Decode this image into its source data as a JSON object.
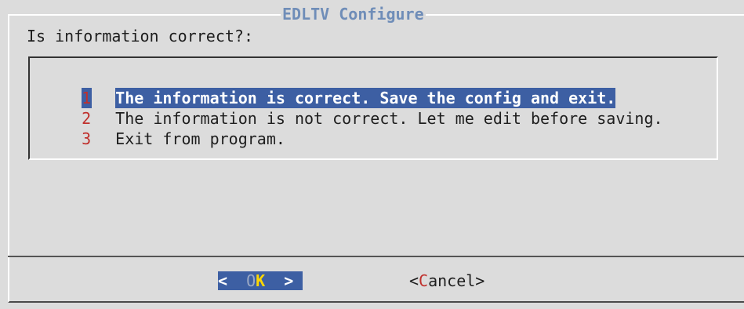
{
  "dialog": {
    "title": "EDLTV Configure",
    "prompt": "Is information correct?:"
  },
  "menu": {
    "items": [
      {
        "tag": "1",
        "text": "The information is correct. Save the config and exit.",
        "selected": true
      },
      {
        "tag": "2",
        "text": "The information is not correct. Let me edit before saving.",
        "selected": false
      },
      {
        "tag": "3",
        "text": "Exit from program.",
        "selected": false
      }
    ]
  },
  "buttons": {
    "ok_left": "<  ",
    "ok_letter_o": "O",
    "ok_letter_k": "K",
    "ok_right": "  >",
    "cancel_open": "<",
    "cancel_hotkey": "C",
    "cancel_rest": "ancel>"
  },
  "colors": {
    "background": "#dcdcdc",
    "title": "#6f8db8",
    "selection": "#3d5fa3",
    "hotkey": "#c0302c",
    "ok_hotkey": "#ffd800"
  }
}
